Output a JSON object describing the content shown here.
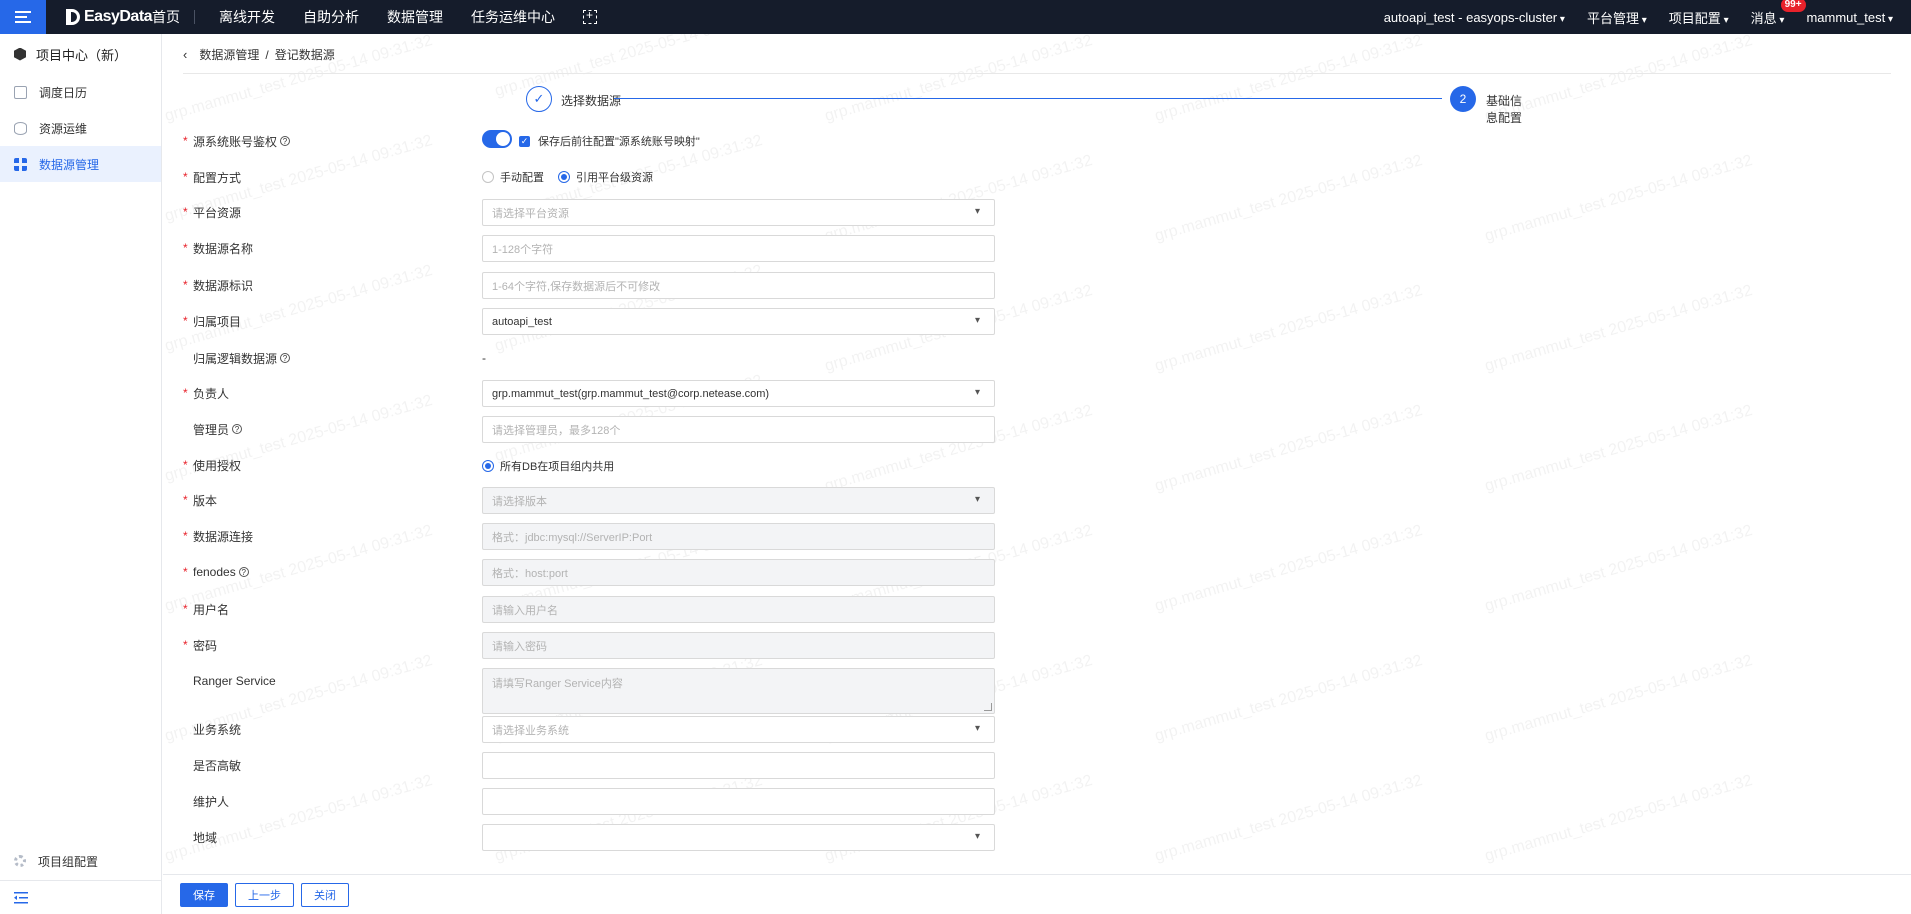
{
  "topbar": {
    "logo": "EasyData",
    "nav": [
      "首页",
      "离线开发",
      "自助分析",
      "数据管理",
      "任务运维中心"
    ],
    "cluster": "autoapi_test - easyops-cluster",
    "platform": "平台管理",
    "project_config": "项目配置",
    "messages": "消息",
    "badge": "99+",
    "user": "mammut_test"
  },
  "sidebar": {
    "title": "项目中心（新）",
    "items": [
      {
        "label": "调度日历",
        "icon": "calendar-icon"
      },
      {
        "label": "资源运维",
        "icon": "database-icon"
      },
      {
        "label": "数据源管理",
        "icon": "grid-icon"
      }
    ],
    "bottom": "项目组配置"
  },
  "breadcrumb": {
    "parent": "数据源管理",
    "separator": "/",
    "current": "登记数据源"
  },
  "steps": {
    "step1": "选择数据源",
    "step2_num": "2",
    "step2": "基础信息配置"
  },
  "form": {
    "account_auth": {
      "label": "源系统账号鉴权",
      "checkbox": "保存后前往配置\"源系统账号映射\""
    },
    "config_mode": {
      "label": "配置方式",
      "opt1": "手动配置",
      "opt2": "引用平台级资源"
    },
    "platform_resource": {
      "label": "平台资源",
      "placeholder": "请选择平台资源"
    },
    "ds_name": {
      "label": "数据源名称",
      "placeholder": "1-128个字符"
    },
    "ds_id": {
      "label": "数据源标识",
      "placeholder": "1-64个字符,保存数据源后不可修改"
    },
    "project": {
      "label": "归属项目",
      "value": "autoapi_test"
    },
    "logical_ds": {
      "label": "归属逻辑数据源",
      "value": "-"
    },
    "owner": {
      "label": "负责人",
      "value": "grp.mammut_test(grp.mammut_test@corp.netease.com)"
    },
    "admin": {
      "label": "管理员",
      "placeholder": "请选择管理员，最多128个"
    },
    "auth": {
      "label": "使用授权",
      "opt": "所有DB在项目组内共用"
    },
    "version": {
      "label": "版本",
      "placeholder": "请选择版本"
    },
    "conn": {
      "label": "数据源连接",
      "placeholder": "格式：jdbc:mysql://ServerIP:Port"
    },
    "fenodes": {
      "label": "fenodes",
      "placeholder": "格式：host:port"
    },
    "username": {
      "label": "用户名",
      "placeholder": "请输入用户名"
    },
    "password": {
      "label": "密码",
      "placeholder": "请输入密码"
    },
    "ranger": {
      "label": "Ranger Service",
      "placeholder": "请填写Ranger Service内容"
    },
    "biz": {
      "label": "业务系统",
      "placeholder": "请选择业务系统"
    },
    "sensitive": {
      "label": "是否高敏"
    },
    "maintainer": {
      "label": "维护人"
    },
    "region": {
      "label": "地域"
    }
  },
  "footer": {
    "save": "保存",
    "prev": "上一步",
    "close": "关闭"
  },
  "watermark": "grp.mammut_test 2025-05-14 09:31:32",
  "colors": {
    "primary": "#2668e8",
    "topbar": "#151c2b",
    "required": "#e8222b"
  }
}
